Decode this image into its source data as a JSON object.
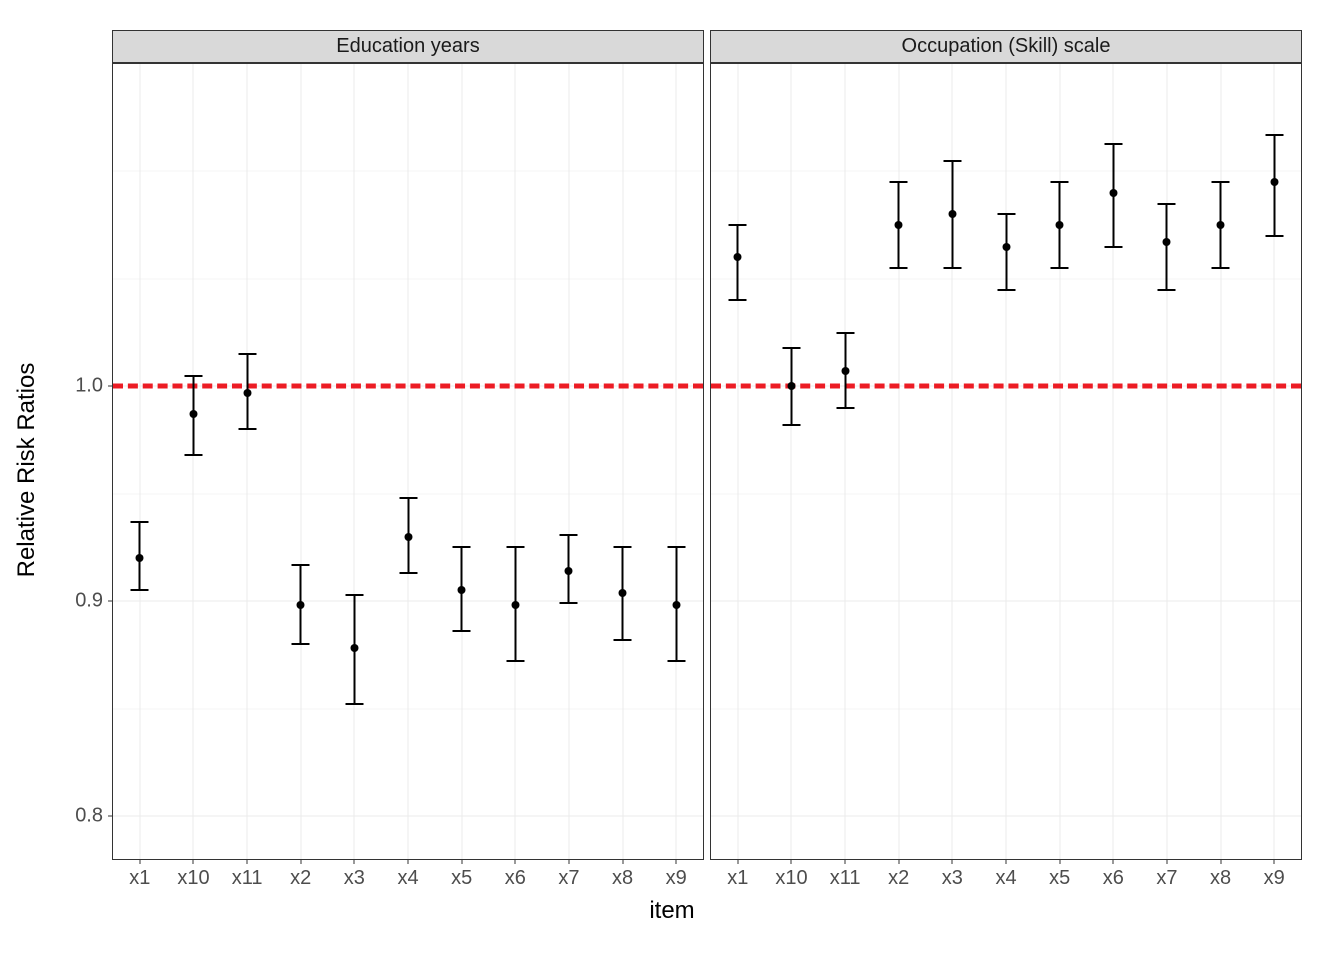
{
  "chart_data": {
    "type": "scatter",
    "xlabel": "item",
    "ylabel": "Relative Risk Ratios",
    "ylim": [
      0.78,
      1.15
    ],
    "y_ticks": [
      0.8,
      0.9,
      1.0
    ],
    "y_tick_labels": [
      "0.8",
      "0.9",
      "1.0"
    ],
    "y_minor_ticks": [
      0.85,
      0.95,
      1.05,
      1.1
    ],
    "reference_line": 1.0,
    "categories": [
      "x1",
      "x10",
      "x11",
      "x2",
      "x3",
      "x4",
      "x5",
      "x6",
      "x7",
      "x8",
      "x9"
    ],
    "facets": [
      {
        "label": "Education years",
        "series": [
          {
            "x": "x1",
            "y": 0.92,
            "ymin": 0.905,
            "ymax": 0.937
          },
          {
            "x": "x10",
            "y": 0.987,
            "ymin": 0.968,
            "ymax": 1.005
          },
          {
            "x": "x11",
            "y": 0.997,
            "ymin": 0.98,
            "ymax": 1.015
          },
          {
            "x": "x2",
            "y": 0.898,
            "ymin": 0.88,
            "ymax": 0.917
          },
          {
            "x": "x3",
            "y": 0.878,
            "ymin": 0.852,
            "ymax": 0.903
          },
          {
            "x": "x4",
            "y": 0.93,
            "ymin": 0.913,
            "ymax": 0.948
          },
          {
            "x": "x5",
            "y": 0.905,
            "ymin": 0.886,
            "ymax": 0.925
          },
          {
            "x": "x6",
            "y": 0.898,
            "ymin": 0.872,
            "ymax": 0.925
          },
          {
            "x": "x7",
            "y": 0.914,
            "ymin": 0.899,
            "ymax": 0.931
          },
          {
            "x": "x8",
            "y": 0.904,
            "ymin": 0.882,
            "ymax": 0.925
          },
          {
            "x": "x9",
            "y": 0.898,
            "ymin": 0.872,
            "ymax": 0.925
          }
        ]
      },
      {
        "label": "Occupation (Skill) scale",
        "series": [
          {
            "x": "x1",
            "y": 1.06,
            "ymin": 1.04,
            "ymax": 1.075
          },
          {
            "x": "x10",
            "y": 1.0,
            "ymin": 0.982,
            "ymax": 1.018
          },
          {
            "x": "x11",
            "y": 1.007,
            "ymin": 0.99,
            "ymax": 1.025
          },
          {
            "x": "x2",
            "y": 1.075,
            "ymin": 1.055,
            "ymax": 1.095
          },
          {
            "x": "x3",
            "y": 1.08,
            "ymin": 1.055,
            "ymax": 1.105
          },
          {
            "x": "x4",
            "y": 1.065,
            "ymin": 1.045,
            "ymax": 1.08
          },
          {
            "x": "x5",
            "y": 1.075,
            "ymin": 1.055,
            "ymax": 1.095
          },
          {
            "x": "x6",
            "y": 1.09,
            "ymin": 1.065,
            "ymax": 1.113
          },
          {
            "x": "x7",
            "y": 1.067,
            "ymin": 1.045,
            "ymax": 1.085
          },
          {
            "x": "x8",
            "y": 1.075,
            "ymin": 1.055,
            "ymax": 1.095
          },
          {
            "x": "x9",
            "y": 1.095,
            "ymin": 1.07,
            "ymax": 1.117
          }
        ]
      }
    ]
  }
}
